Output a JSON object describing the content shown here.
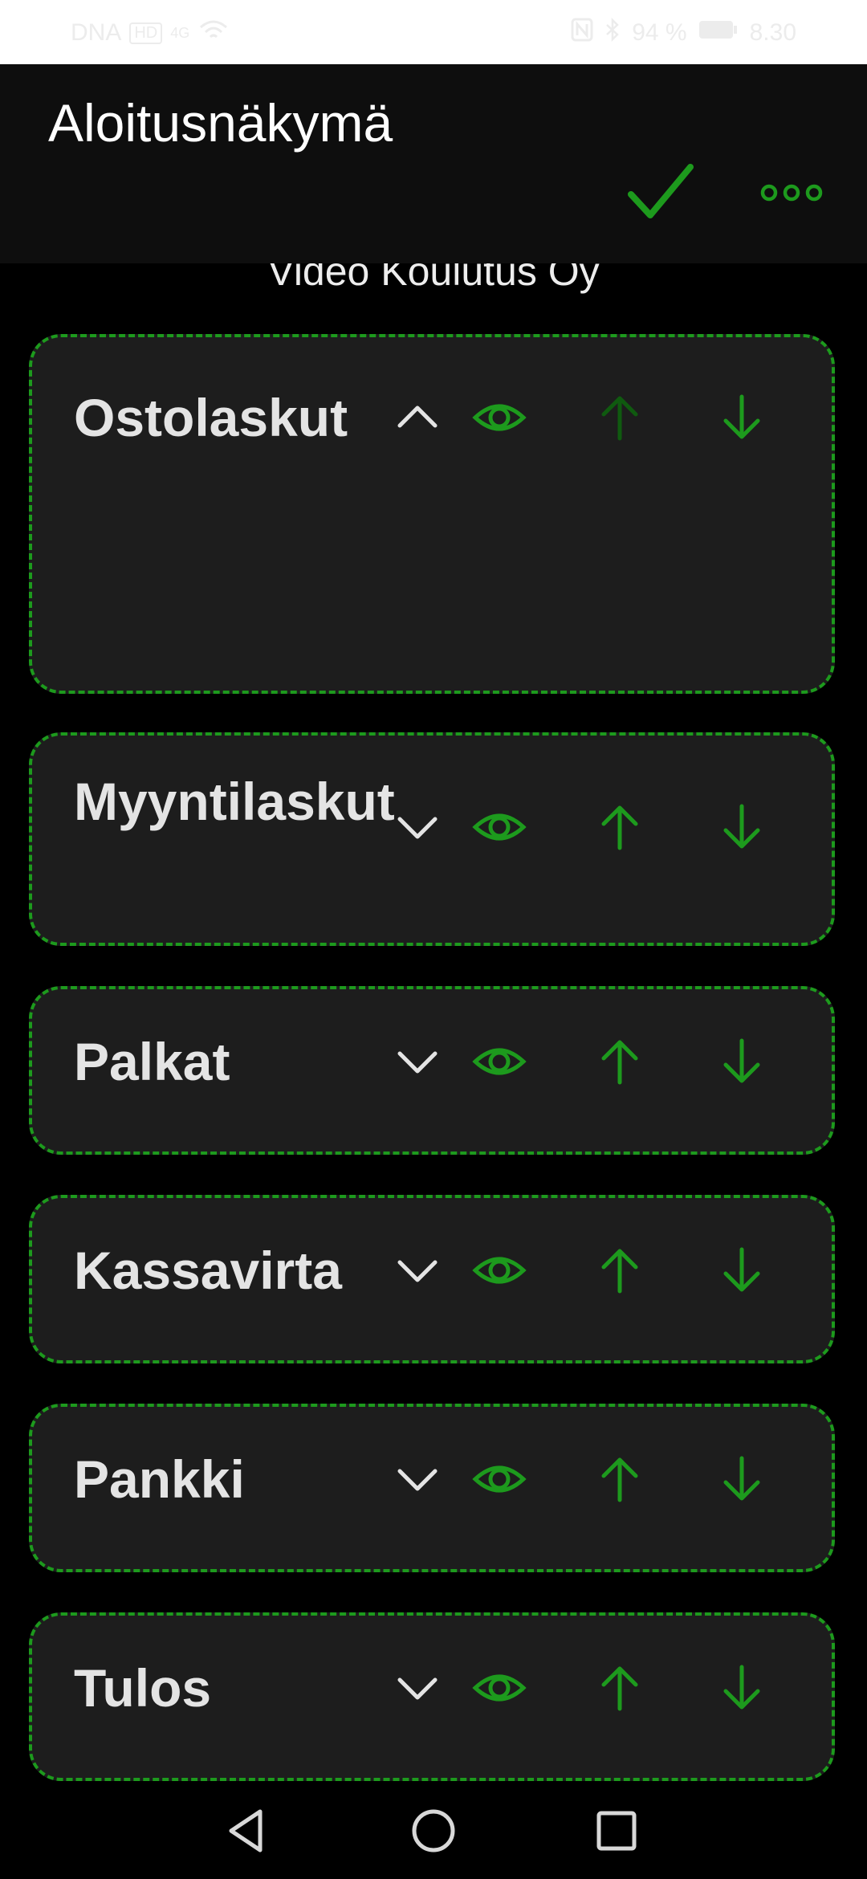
{
  "status_bar": {
    "carrier": "DNA",
    "network_badge": "HD",
    "signal_text": "4G",
    "battery_percent": "94 %",
    "time": "8.30"
  },
  "app_bar": {
    "title": "Aloitusnäkymä",
    "confirm_icon": "check-icon",
    "more_icon": "more-horizontal-icon"
  },
  "company": {
    "name": "Video Koulutus Oy"
  },
  "cards": [
    {
      "title": "Ostolaskut",
      "expanded": true,
      "expand_icon": "chevron-up-icon",
      "move_up_enabled": false
    },
    {
      "title": "Myyntilaskut",
      "expanded": false,
      "expand_icon": "chevron-down-icon",
      "move_up_enabled": true
    },
    {
      "title": "Palkat",
      "expanded": false,
      "expand_icon": "chevron-down-icon",
      "move_up_enabled": true
    },
    {
      "title": "Kassavirta",
      "expanded": false,
      "expand_icon": "chevron-down-icon",
      "move_up_enabled": true
    },
    {
      "title": "Pankki",
      "expanded": false,
      "expand_icon": "chevron-down-icon",
      "move_up_enabled": true
    },
    {
      "title": "Tulos",
      "expanded": false,
      "expand_icon": "chevron-down-icon",
      "move_up_enabled": true
    }
  ],
  "colors": {
    "accent": "#1d9a1d",
    "accent_disabled": "#0f5a0f",
    "card_bg": "#1d1d1d",
    "background": "#000000"
  },
  "nav_bar": {
    "back_icon": "back-triangle-icon",
    "home_icon": "home-circle-icon",
    "recents_icon": "recents-square-icon"
  }
}
